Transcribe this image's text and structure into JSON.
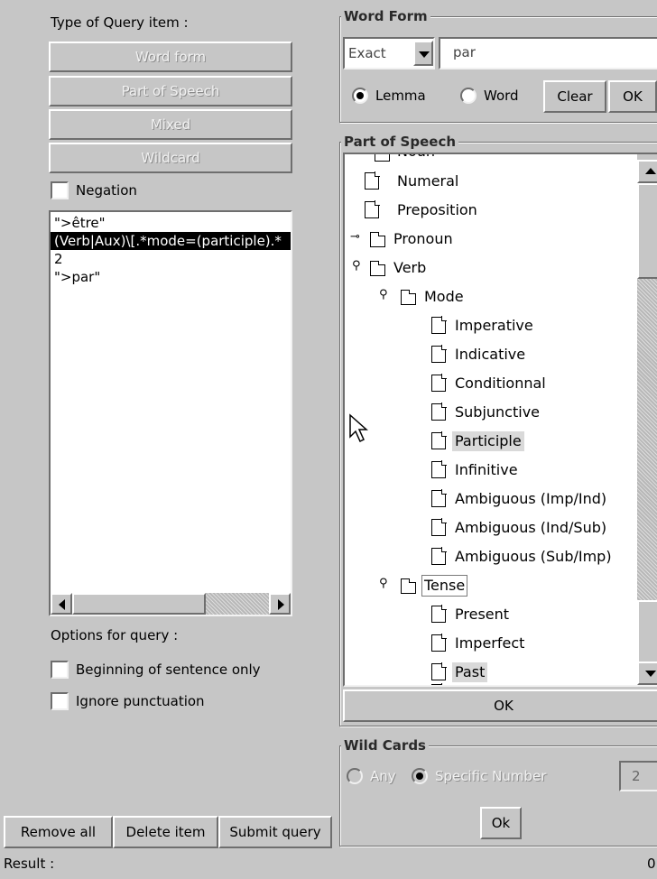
{
  "left": {
    "type_heading": "Type of Query item :",
    "type_buttons": [
      "Word form",
      "Part of Speech",
      "Mixed",
      "Wildcard"
    ],
    "negation_label": "Negation",
    "query_lines": [
      "\">être\"",
      "(Verb|Aux)\\[.*mode=(participle).*",
      "2",
      "\">par\""
    ],
    "options_heading": "Options for query :",
    "option_beginning": "Beginning of sentence only",
    "option_punct": "Ignore punctuation",
    "buttons": {
      "remove_all": "Remove all",
      "delete_item": "Delete item",
      "submit": "Submit query"
    }
  },
  "word_form": {
    "title": "Word Form",
    "match_value": "Exact",
    "text_value": "par",
    "radio_lemma": "Lemma",
    "radio_word": "Word",
    "selected": "Lemma",
    "clear": "Clear",
    "ok": "OK"
  },
  "pos": {
    "title": "Part of Speech",
    "partial_top": "Noun",
    "items": {
      "numeral": "Numeral",
      "preposition": "Preposition",
      "pronoun": "Pronoun",
      "verb": "Verb",
      "mode": "Mode",
      "imperative": "Imperative",
      "indicative": "Indicative",
      "conditionnal": "Conditionnal",
      "subjunctive": "Subjunctive",
      "participle": "Participle",
      "infinitive": "Infinitive",
      "amb_imp_ind": "Ambiguous (Imp/Ind)",
      "amb_ind_sub": "Ambiguous (Ind/Sub)",
      "amb_sub_imp": "Ambiguous (Sub/Imp)",
      "tense": "Tense",
      "present": "Present",
      "imperfect": "Imperfect",
      "past": "Past"
    },
    "selected": "Participle",
    "ok": "OK"
  },
  "wild": {
    "title": "Wild Cards",
    "any": "Any",
    "specific": "Specific Number",
    "number": "2",
    "ok": "Ok"
  },
  "status": {
    "result_label": "Result :",
    "count": "0"
  }
}
